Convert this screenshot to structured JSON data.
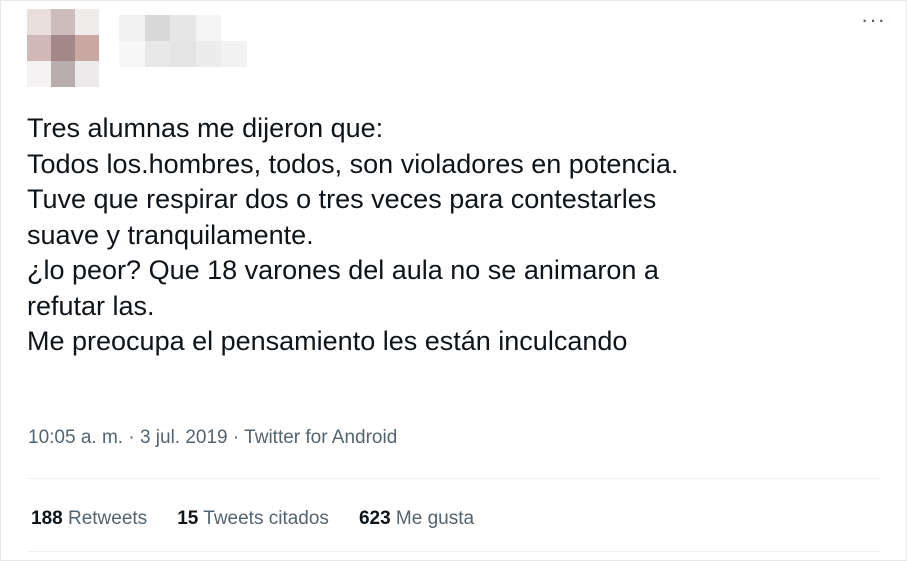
{
  "tweet": {
    "lines": [
      "Tres alumnas me dijeron que:",
      "Todos los.hombres, todos, son violadores en potencia.",
      "Tuve que respirar dos o tres veces para contestarles",
      "suave y tranquilamente.",
      "¿lo peor? Que 18 varones del aula no se animaron a",
      "refutar las.",
      "Me preocupa el pensamiento les están inculcando"
    ],
    "timestamp": "10:05 a. m. · 3 jul. 2019 · Twitter for Android"
  },
  "stats": {
    "retweets_count": "188",
    "retweets_label": "Retweets",
    "quotes_count": "15",
    "quotes_label": "Tweets citados",
    "likes_count": "623",
    "likes_label": "Me gusta"
  },
  "more_icon": "more-horizontal-icon",
  "colors": {
    "text": "#0f1419",
    "secondary": "#536471",
    "border": "#eff3f4"
  }
}
